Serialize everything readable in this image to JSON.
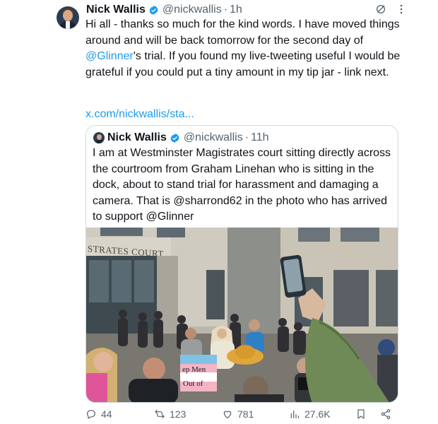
{
  "author": {
    "name": "Nick Wallis",
    "handle": "@nickwallis",
    "separator": "·",
    "time": "1h"
  },
  "tweet": {
    "text_part1": "Hi all - thanks so much for the kind words. I have moved things around and will be back tomorrow for the second day of ",
    "mention": "@Glinner",
    "text_part2": "'s trial. If you found my live-tweeting useful I would be grateful if you could put a tiny amount in my tip jar - link next.",
    "link": "x.com/nickwallis/sta..."
  },
  "quoted": {
    "name": "Nick Wallis",
    "handle": "@nickwallis",
    "separator": "·",
    "time": "11h",
    "text": "I am at Westminster Magistrates court sitting directly across the courtroom from Graham Linehan who is sitting in the dock, about to stand trial for harassment and damaging a camera. That is @sharrond62 in the photo who has arrived to support @Glinner",
    "photo": {
      "building_sign": "STRATES COURT",
      "placard_line1": "ep Men",
      "placard_line2": "Out of"
    }
  },
  "actions": {
    "replies": "44",
    "reposts": "123",
    "likes": "781",
    "views": "27.6K"
  },
  "colors": {
    "link": "#1d9bf0",
    "text": "#0f1419",
    "muted": "#536471",
    "verified": "#1d9bf0",
    "border": "#cfd9de"
  },
  "icons": [
    "grok-icon",
    "more-icon",
    "verified-badge-icon",
    "reply-icon",
    "repost-icon",
    "like-icon",
    "views-icon",
    "bookmark-icon",
    "share-icon"
  ]
}
